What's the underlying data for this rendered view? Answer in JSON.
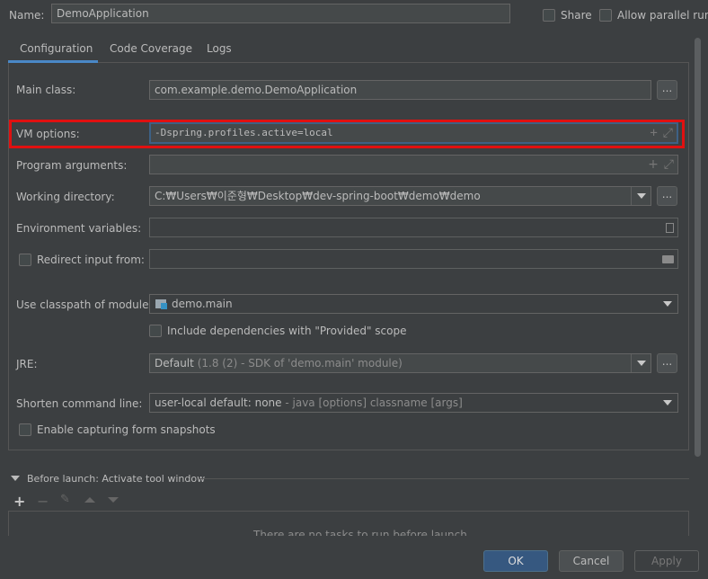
{
  "header": {
    "name_label": "Name:",
    "name_value": "DemoApplication",
    "share_label": "Share",
    "parallel_label": "Allow parallel run"
  },
  "tabs": [
    {
      "label": "Configuration"
    },
    {
      "label": "Code Coverage"
    },
    {
      "label": "Logs"
    }
  ],
  "form": {
    "main_class": {
      "label": "Main class:",
      "value": "com.example.demo.DemoApplication"
    },
    "vm_options": {
      "label": "VM options:",
      "value": "-Dspring.profiles.active=local"
    },
    "program_args": {
      "label": "Program arguments:",
      "value": ""
    },
    "working_dir": {
      "label": "Working directory:",
      "value": "C:₩Users₩이준형₩Desktop₩dev-spring-boot₩demo₩demo"
    },
    "env_vars": {
      "label": "Environment variables:",
      "value": ""
    },
    "redirect_input": {
      "label": "Redirect input from:",
      "value": ""
    },
    "classpath_module": {
      "label": "Use classpath of module:",
      "value": "demo.main"
    },
    "include_deps": {
      "label": "Include dependencies with \"Provided\" scope"
    },
    "jre": {
      "label": "JRE:",
      "value_main": "Default",
      "value_detail": "(1.8 (2) - SDK of 'demo.main' module)"
    },
    "shorten_cmd": {
      "label": "Shorten command line:",
      "value_main": "user-local default: none",
      "value_detail": "- java [options] classname [args]"
    },
    "capture_snapshots": {
      "label": "Enable capturing form snapshots"
    },
    "dots": "..."
  },
  "before_launch": {
    "title": "Before launch: Activate tool window",
    "empty_text": "There are no tasks to run before launch"
  },
  "buttons": {
    "ok": "OK",
    "cancel": "Cancel",
    "apply": "Apply"
  },
  "colors": {
    "background": "#3c3f41",
    "field_bg": "#45494a",
    "highlight_red": "#e01010",
    "focus_blue": "#3d6185",
    "ok_blue": "#365880"
  }
}
